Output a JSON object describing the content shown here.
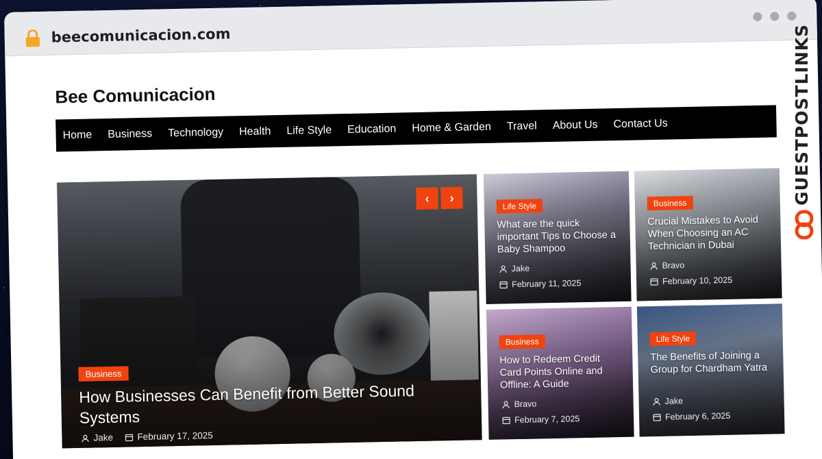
{
  "browser": {
    "url": "beecomunicacion.com"
  },
  "site": {
    "title": "Bee Comunicacion"
  },
  "nav": {
    "items": [
      "Home",
      "Business",
      "Technology",
      "Health",
      "Life Style",
      "Education",
      "Home & Garden",
      "Travel",
      "About Us",
      "Contact Us"
    ]
  },
  "hero": {
    "category": "Business",
    "title": "How Businesses Can Benefit from Better Sound Systems",
    "author": "Jake",
    "date": "February 17, 2025",
    "prev_label": "‹",
    "next_label": "›"
  },
  "cards": [
    {
      "category": "Life Style",
      "title": "What are the quick important Tips to Choose a Baby Shampoo",
      "author": "Jake",
      "date": "February 11, 2025"
    },
    {
      "category": "Business",
      "title": "Crucial Mistakes to Avoid When Choosing an AC Technician in Dubai",
      "author": "Bravo",
      "date": "February 10, 2025"
    },
    {
      "category": "Business",
      "title": "How to Redeem Credit Card Points Online and Offline: A Guide",
      "author": "Bravo",
      "date": "February 7, 2025"
    },
    {
      "category": "Life Style",
      "title": "The Benefits of Joining a Group for Chardham Yatra",
      "author": "Jake",
      "date": "February 6, 2025"
    }
  ],
  "watermark": {
    "text": "GUESTPOSTLINKS"
  },
  "colors": {
    "accent": "#f0430f",
    "nav_bg": "#000000",
    "chrome_bg": "#e8e9ed"
  },
  "icons": {
    "lock": "lock-icon",
    "author": "user-icon",
    "date": "calendar-icon"
  }
}
